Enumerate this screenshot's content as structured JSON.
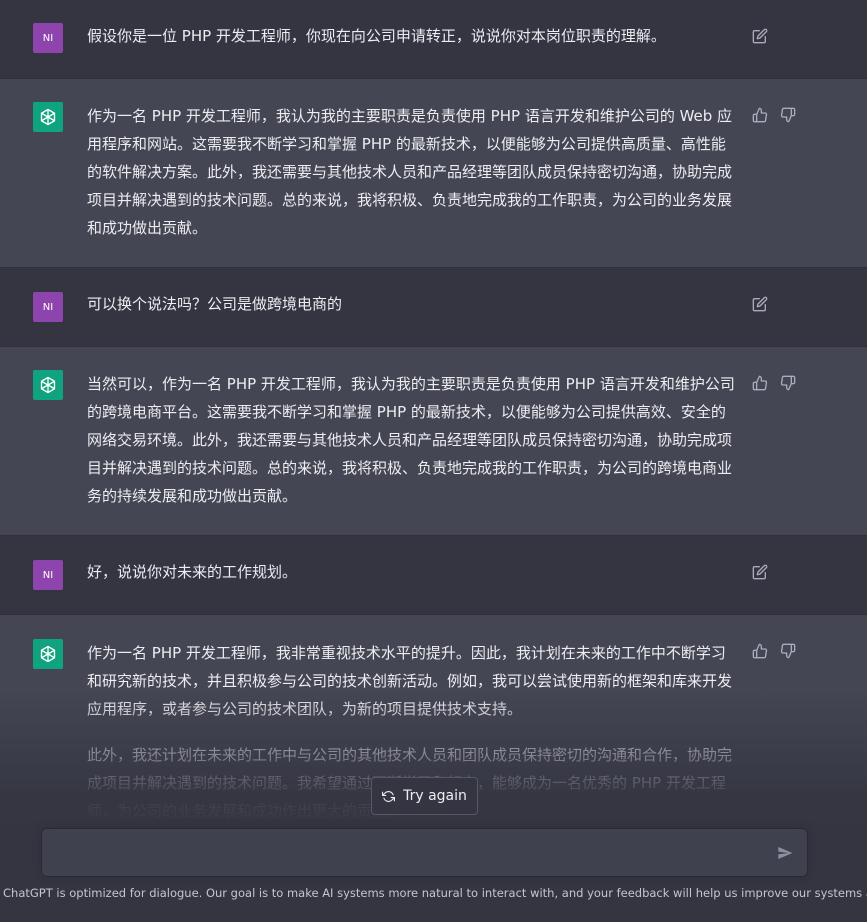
{
  "conversation": [
    {
      "role": "user",
      "avatar": "NI",
      "text": [
        "假设你是一位 PHP 开发工程师，你现在向公司申请转正，说说你对本岗位职责的理解。"
      ]
    },
    {
      "role": "assistant",
      "text": [
        "作为一名 PHP 开发工程师，我认为我的主要职责是负责使用 PHP 语言开发和维护公司的 Web 应用程序和网站。这需要我不断学习和掌握 PHP 的最新技术，以便能够为公司提供高质量、高性能的软件解决方案。此外，我还需要与其他技术人员和产品经理等团队成员保持密切沟通，协助完成项目并解决遇到的技术问题。总的来说，我将积极、负责地完成我的工作职责，为公司的业务发展和成功做出贡献。"
      ]
    },
    {
      "role": "user",
      "avatar": "NI",
      "text": [
        "可以换个说法吗？公司是做跨境电商的"
      ]
    },
    {
      "role": "assistant",
      "text": [
        "当然可以，作为一名 PHP 开发工程师，我认为我的主要职责是负责使用 PHP 语言开发和维护公司的跨境电商平台。这需要我不断学习和掌握 PHP 的最新技术，以便能够为公司提供高效、安全的网络交易环境。此外，我还需要与其他技术人员和产品经理等团队成员保持密切沟通，协助完成项目并解决遇到的技术问题。总的来说，我将积极、负责地完成我的工作职责，为公司的跨境电商业务的持续发展和成功做出贡献。"
      ]
    },
    {
      "role": "user",
      "avatar": "NI",
      "text": [
        "好，说说你对未来的工作规划。"
      ]
    },
    {
      "role": "assistant",
      "text": [
        "作为一名 PHP 开发工程师，我非常重视技术水平的提升。因此，我计划在未来的工作中不断学习和研究新的技术，并且积极参与公司的技术创新活动。例如，我可以尝试使用新的框架和库来开发应用程序，或者参与公司的技术团队，为新的项目提供技术支持。",
        "此外，我还计划在未来的工作中与公司的其他技术人员和团队成员保持密切的沟通和合作，协助完成项目并解决遇到的技术问题。我希望通过不断学习和努力，能够成为一名优秀的 PHP 开发工程师，为公司的业务发展和成功作出更大的贡献。"
      ]
    }
  ],
  "try_again_label": "Try again",
  "input": {
    "value": "",
    "placeholder": ""
  },
  "footer_text": "ChatGPT is optimized for dialogue. Our goal is to make AI systems more natural to interact with, and your feedback will help us improve our systems and make them safer.",
  "colors": {
    "user_bg": "#343541",
    "bot_bg": "#444654",
    "user_avatar": "#8e44ad",
    "bot_avatar": "#10a37f"
  }
}
